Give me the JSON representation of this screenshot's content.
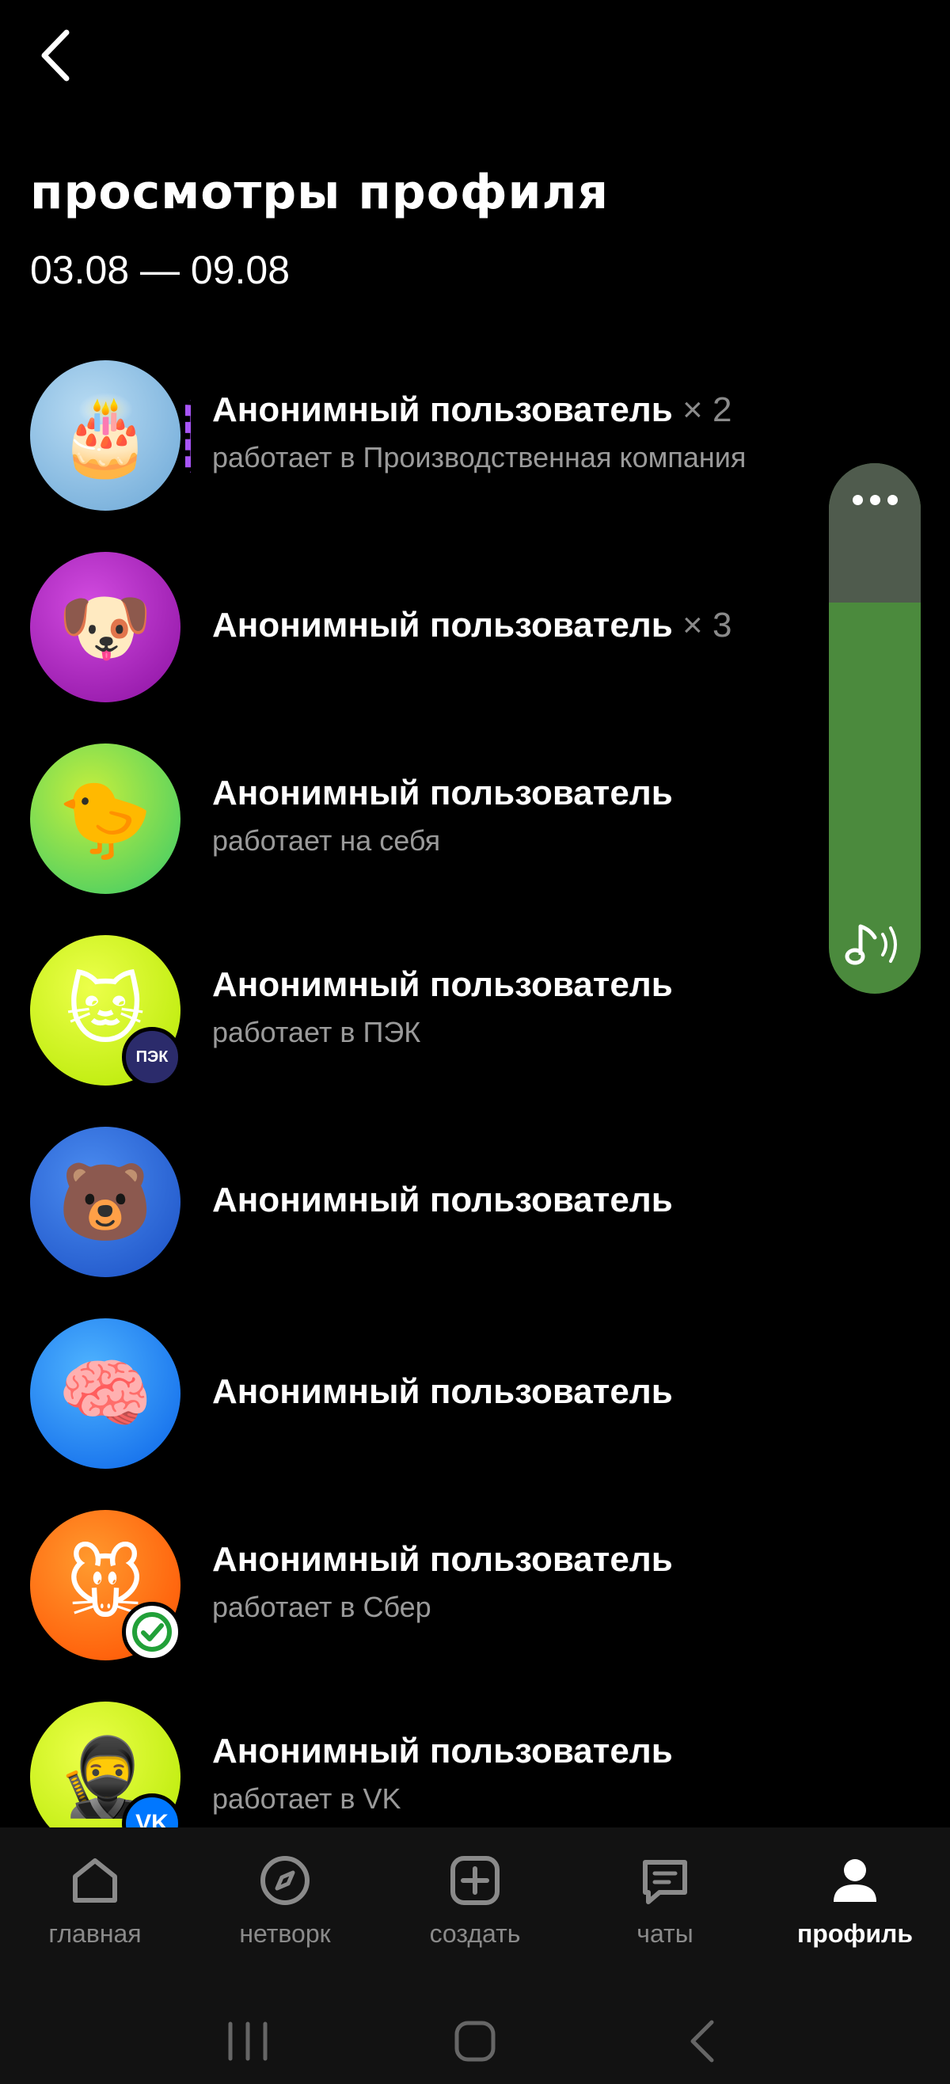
{
  "header": {
    "title": "просмотры профиля",
    "date_range": "03.08 — 09.08"
  },
  "viewers": [
    {
      "name": "Анонимный пользователь",
      "count": "× 2",
      "subtitle": "работает в Производственная компания",
      "avatar_icon": "cake-emoji",
      "bg": "#7fb6dc",
      "story": true
    },
    {
      "name": "Анонимный пользователь",
      "count": "× 3",
      "subtitle": "",
      "avatar_icon": "dog-emoji",
      "bg": "#b01fc0"
    },
    {
      "name": "Анонимный пользователь",
      "count": "",
      "subtitle": "работает на себя",
      "avatar_icon": "chick-emoji",
      "bg": "#6bd65a"
    },
    {
      "name": "Анонимный пользователь",
      "count": "",
      "subtitle": "работает в ПЭК",
      "avatar_icon": "cat-emoji",
      "bg": "#d4ff1a",
      "badge": "ПЭК",
      "badge_color": "#2b2b6b"
    },
    {
      "name": "Анонимный пользователь",
      "count": "",
      "subtitle": "",
      "avatar_icon": "bear-emoji",
      "bg": "#2e6fe6"
    },
    {
      "name": "Анонимный пользователь",
      "count": "",
      "subtitle": "",
      "avatar_icon": "brain-emoji",
      "bg": "#1e88ff"
    },
    {
      "name": "Анонимный пользователь",
      "count": "",
      "subtitle": "работает в Сбер",
      "avatar_icon": "mouse-emoji",
      "bg": "#ff6a00",
      "badge": "✓",
      "badge_color": "#21a038"
    },
    {
      "name": "Анонимный пользователь",
      "count": "",
      "subtitle": "работает в VK",
      "avatar_icon": "ninja-emoji",
      "bg": "#d4ff1a",
      "badge": "VK",
      "badge_color": "#0077ff"
    }
  ],
  "nav": {
    "items": [
      {
        "label": "главная",
        "icon": "home-icon"
      },
      {
        "label": "нетворк",
        "icon": "compass-icon"
      },
      {
        "label": "создать",
        "icon": "plus-square-icon"
      },
      {
        "label": "чаты",
        "icon": "chat-icon"
      },
      {
        "label": "профиль",
        "icon": "profile-icon",
        "active": true
      }
    ]
  },
  "colors": {
    "background": "#000000",
    "nav_background": "#121212",
    "volume_green": "#4b8a3d"
  }
}
